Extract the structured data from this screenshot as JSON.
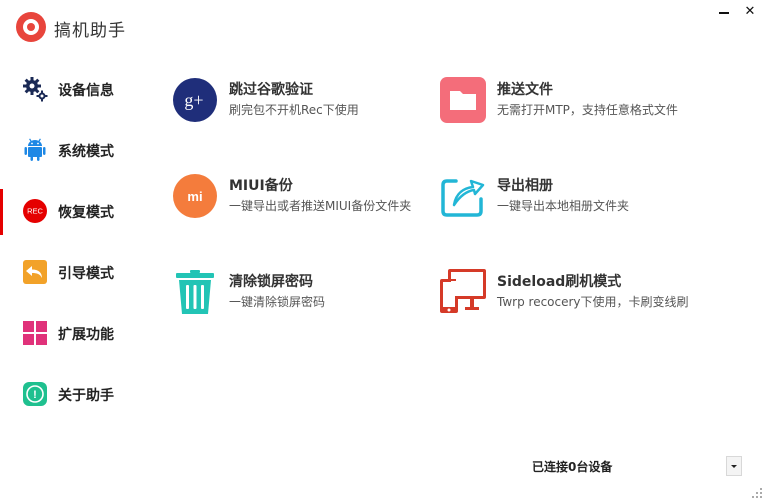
{
  "app": {
    "title": "搞机助手",
    "brand_color": "#e8453c",
    "logo": "app-logo-icon"
  },
  "window": {
    "minimize_icon": "minimize-icon",
    "close_label": "✕"
  },
  "sidebar": {
    "active_index": 2,
    "items": [
      {
        "label": "设备信息",
        "icon": "gears-icon"
      },
      {
        "label": "系统模式",
        "icon": "android-icon"
      },
      {
        "label": "恢复模式",
        "icon": "rec-icon",
        "icon_text": "REC"
      },
      {
        "label": "引导模式",
        "icon": "back-arrow-icon"
      },
      {
        "label": "扩展功能",
        "icon": "grid-icon"
      },
      {
        "label": "关于助手",
        "icon": "info-icon",
        "icon_text": "!"
      }
    ]
  },
  "cards": [
    {
      "title": "跳过谷歌验证",
      "desc": "刷完包不开机Rec下使用",
      "icon": "google-plus-icon",
      "icon_text": "g+",
      "color": "#1f2e7a"
    },
    {
      "title": "推送文件",
      "desc": "无需打开MTP，支持任意格式文件",
      "icon": "folder-icon",
      "color": "#f46d7a"
    },
    {
      "title": "MIUI备份",
      "desc": "一键导出或者推送MIUI备份文件夹",
      "icon": "mi-icon",
      "icon_text": "mi",
      "color": "#f47c3c"
    },
    {
      "title": "导出相册",
      "desc": "一键导出本地相册文件夹",
      "icon": "export-icon",
      "color": "#22b6d6"
    },
    {
      "title": "清除锁屏密码",
      "desc": "一键清除锁屏密码",
      "icon": "trash-icon",
      "color": "#22c4b5"
    },
    {
      "title": "Sideload刷机模式",
      "desc": "Twrp recocery下使用，卡刷变线刷",
      "icon": "devices-icon",
      "color": "#d53a28"
    }
  ],
  "status": {
    "text": "已连接0台设备"
  }
}
